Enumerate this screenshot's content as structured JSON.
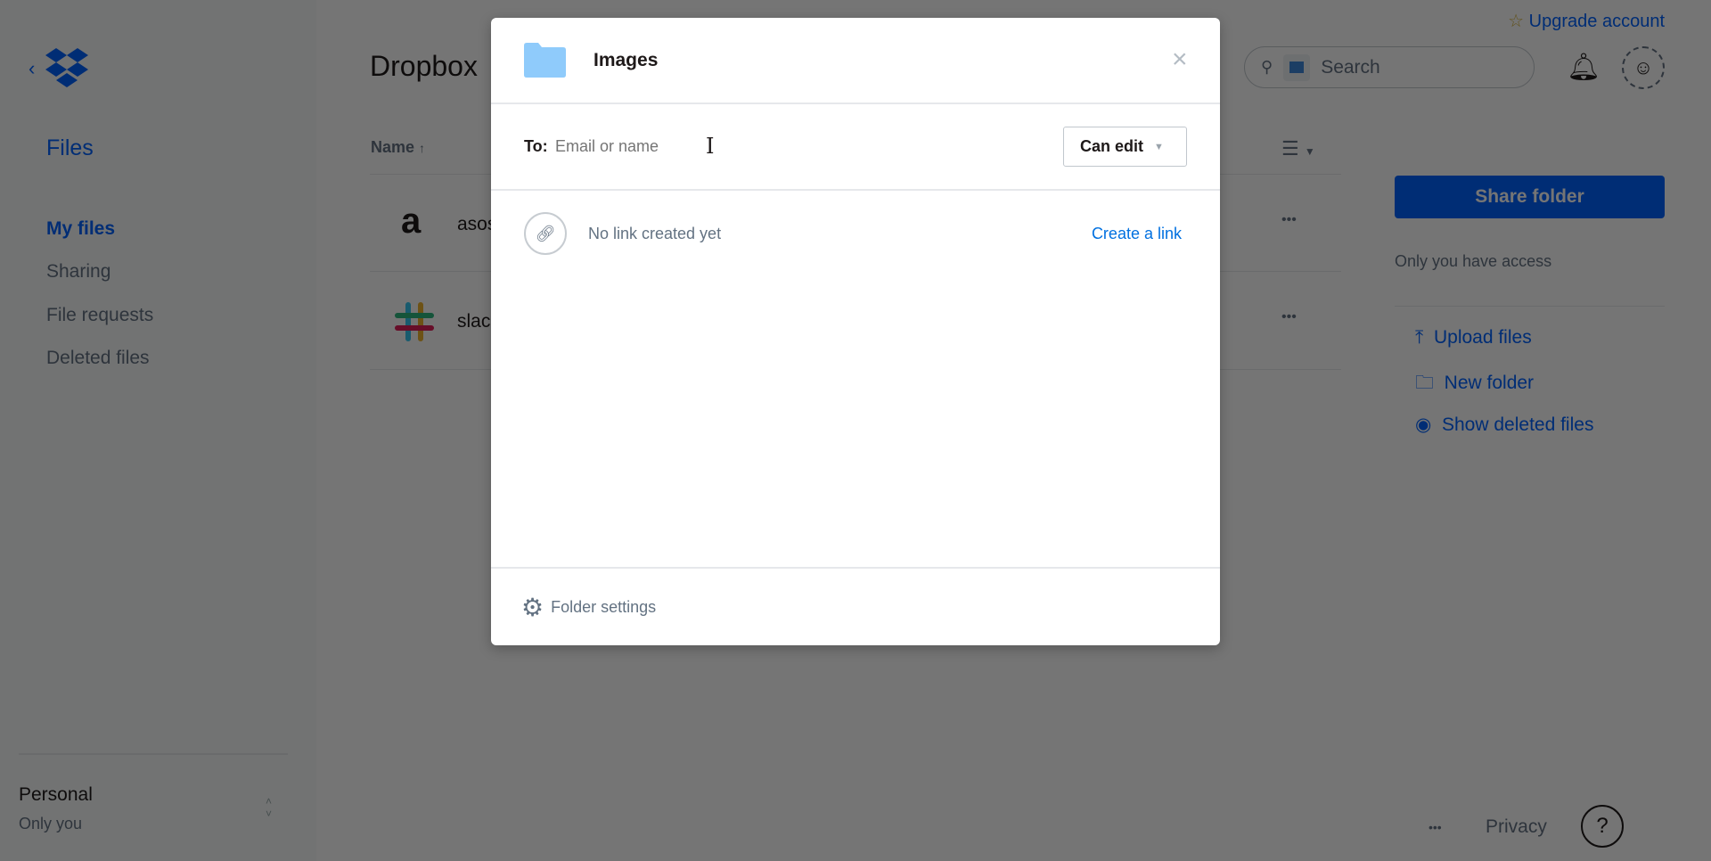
{
  "sidebar": {
    "back_icon": "chevron-left-icon",
    "logo": "dropbox-logo",
    "section_title": "Files",
    "items": [
      {
        "label": "My files",
        "active": true
      },
      {
        "label": "Sharing"
      },
      {
        "label": "File requests"
      },
      {
        "label": "Deleted files"
      }
    ],
    "account": {
      "name": "Personal",
      "subtitle": "Only you"
    }
  },
  "header": {
    "title": "Dropbox",
    "upgrade": "Upgrade account",
    "search_placeholder": "Search"
  },
  "file_list": {
    "column_name": "Name",
    "sort": "ascending",
    "rows": [
      {
        "name": "asos",
        "icon": "asos-logo"
      },
      {
        "name": "slack",
        "icon": "slack-logo"
      }
    ]
  },
  "right_panel": {
    "share_button": "Share folder",
    "access": "Only you have access",
    "actions": [
      {
        "label": "Upload files",
        "icon": "upload-icon"
      },
      {
        "label": "New folder",
        "icon": "folder-icon"
      },
      {
        "label": "Show deleted files",
        "icon": "eye-icon"
      }
    ]
  },
  "footer": {
    "more": "•••",
    "privacy": "Privacy",
    "help": "?"
  },
  "modal": {
    "title": "Images",
    "to_label": "To:",
    "to_placeholder": "Email or name",
    "permission": "Can edit",
    "link_status": "No link created yet",
    "create_link": "Create a link",
    "settings": "Folder settings"
  },
  "colors": {
    "accent": "#0061fe",
    "folder": "#8fcbfb"
  }
}
